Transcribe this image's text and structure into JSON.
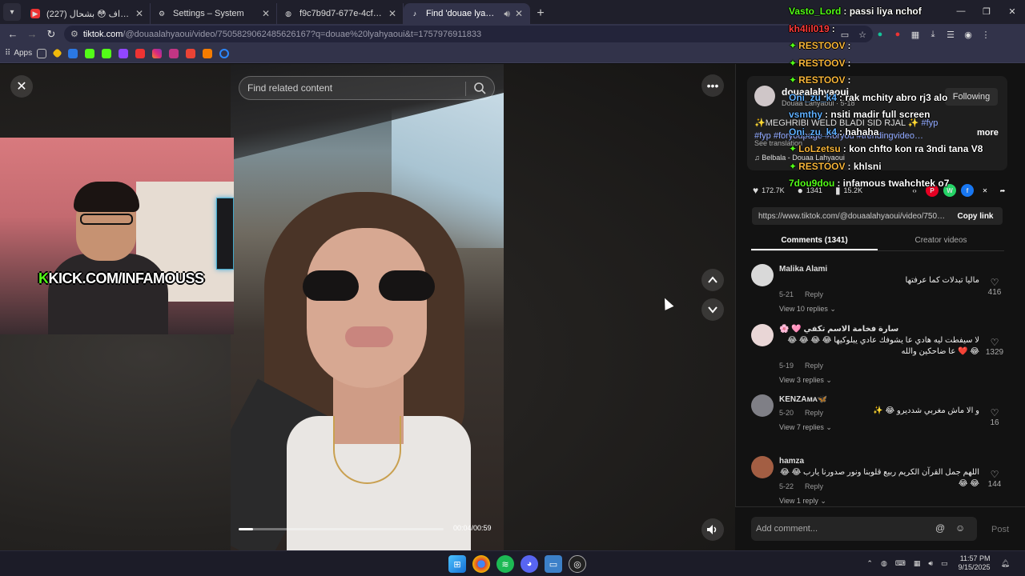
{
  "browser": {
    "tabs": [
      {
        "title": "(227) كتكوتصومي براف 😳 بشحال",
        "icon": "youtube-icon",
        "active": false
      },
      {
        "title": "Settings – System",
        "icon": "gear-icon",
        "active": false
      },
      {
        "title": "f9c7b9d7-677e-4cf3-9941-fef7…",
        "icon": "globe-icon",
        "active": false
      },
      {
        "title": "Find 'douae lyahyaoui' on T…",
        "icon": "tiktok-icon",
        "active": true
      }
    ],
    "url_host": "tiktok.com",
    "url_path": "/@douaalahyaoui/video/7505829062485626167?q=douae%20lyahyaoui&t=1757976911833",
    "bookmarks_apps_label": "Apps",
    "window_buttons": [
      "—",
      "❐",
      "✕"
    ]
  },
  "player": {
    "search_placeholder": "Find related content",
    "time": "00:04/00:59",
    "progress": 0.07
  },
  "overlay": {
    "kick_url": "KICK.COM/INFAMOUSS"
  },
  "chat": [
    {
      "user": "Vasto_Lord",
      "msg": "passi liya nchof",
      "color": "#53fc18",
      "gem": false
    },
    {
      "user": "kh4lil019",
      "msg": "",
      "color": "#ff3b3b",
      "gem": false
    },
    {
      "user": "RESTOOV",
      "msg": "",
      "color": "#f6b53a",
      "gem": true
    },
    {
      "user": "RESTOOV",
      "msg": "",
      "color": "#f6b53a",
      "gem": true
    },
    {
      "user": "RESTOOV",
      "msg": "",
      "color": "#f6b53a",
      "gem": true
    },
    {
      "user": "Oni_zu_k4",
      "msg": "rak mchity abro rj3 alo",
      "color": "#5fb0ff",
      "gem": false
    },
    {
      "user": "vsmthy",
      "msg": "nsiti madir full screen",
      "color": "#5fb0ff",
      "gem": false
    },
    {
      "user": "Oni_zu_k4",
      "msg": "hahaha",
      "color": "#5fb0ff",
      "gem": false
    },
    {
      "user": "LoLzetsu",
      "msg": "kon chfto kon ra 3ndi tana V8",
      "color": "#f6b53a",
      "gem": true
    },
    {
      "user": "RESTOOV",
      "msg": "khlsni",
      "color": "#f6b53a",
      "gem": true
    },
    {
      "user": "7dou9dou",
      "msg": "infamous twahchtek o7",
      "color": "#53fc18",
      "gem": false
    }
  ],
  "post": {
    "author": "douaalahyaoui",
    "author_sub": "Douaa Lahyaoui · 5-18",
    "follow_label": "Following",
    "description": "✨MEGHRIBI WELD BLADI SID RJAL ✨",
    "tags": "#fyp #fyp #foryoupage #foryou #trendingvideo…",
    "more_label": "more",
    "see_translation": "See translation",
    "music": "♫  Belbala - Douaa Lahyaoui",
    "likes": "172.7K",
    "comments_count": "1341",
    "saves": "15.2K",
    "link": "https://www.tiktok.com/@douaalahyaoui/video/75058…",
    "copy_label": "Copy link",
    "tab_comments": "Comments (1341)",
    "tab_creator": "Creator videos"
  },
  "comments": [
    {
      "name": "Malika Alami",
      "text": "ماليا تبدلات كما عرفتها",
      "date": "5-21",
      "reply": "Reply",
      "replies": "View 10 replies",
      "likes": "416",
      "avatar": "#d9d9d9"
    },
    {
      "name": "🌸 🩷 سارة فخامة الاسم تكفي",
      "text": "لا سيفطت ليه هادي عا يشوفك عادي يبلوكيها 😂 😂 😂 😂 😂 ❤️ عا ضاحكين والله",
      "date": "5-19",
      "reply": "Reply",
      "replies": "View 3 replies",
      "likes": "1329",
      "avatar": "#e9d6d6"
    },
    {
      "name": "KENZAᴍᴀ🦋",
      "text": "و الا ماش مغربي شدديرو 😂 ✨",
      "date": "5-20",
      "reply": "Reply",
      "replies": "View 7 replies",
      "likes": "16",
      "avatar": "#7f7f86"
    },
    {
      "name": "hamza",
      "text": "اللهم جمل القرآن الكريم ربيع قلوبنا ونور صدورنا يارب 😂 😂 😂 😂",
      "date": "5-22",
      "reply": "Reply",
      "replies": "View 1 reply",
      "likes": "144",
      "avatar": "#a35e43"
    }
  ],
  "compose": {
    "placeholder": "Add comment...",
    "post_label": "Post"
  },
  "taskbar": {
    "time": "11:57 PM",
    "date": "9/15/2025"
  }
}
